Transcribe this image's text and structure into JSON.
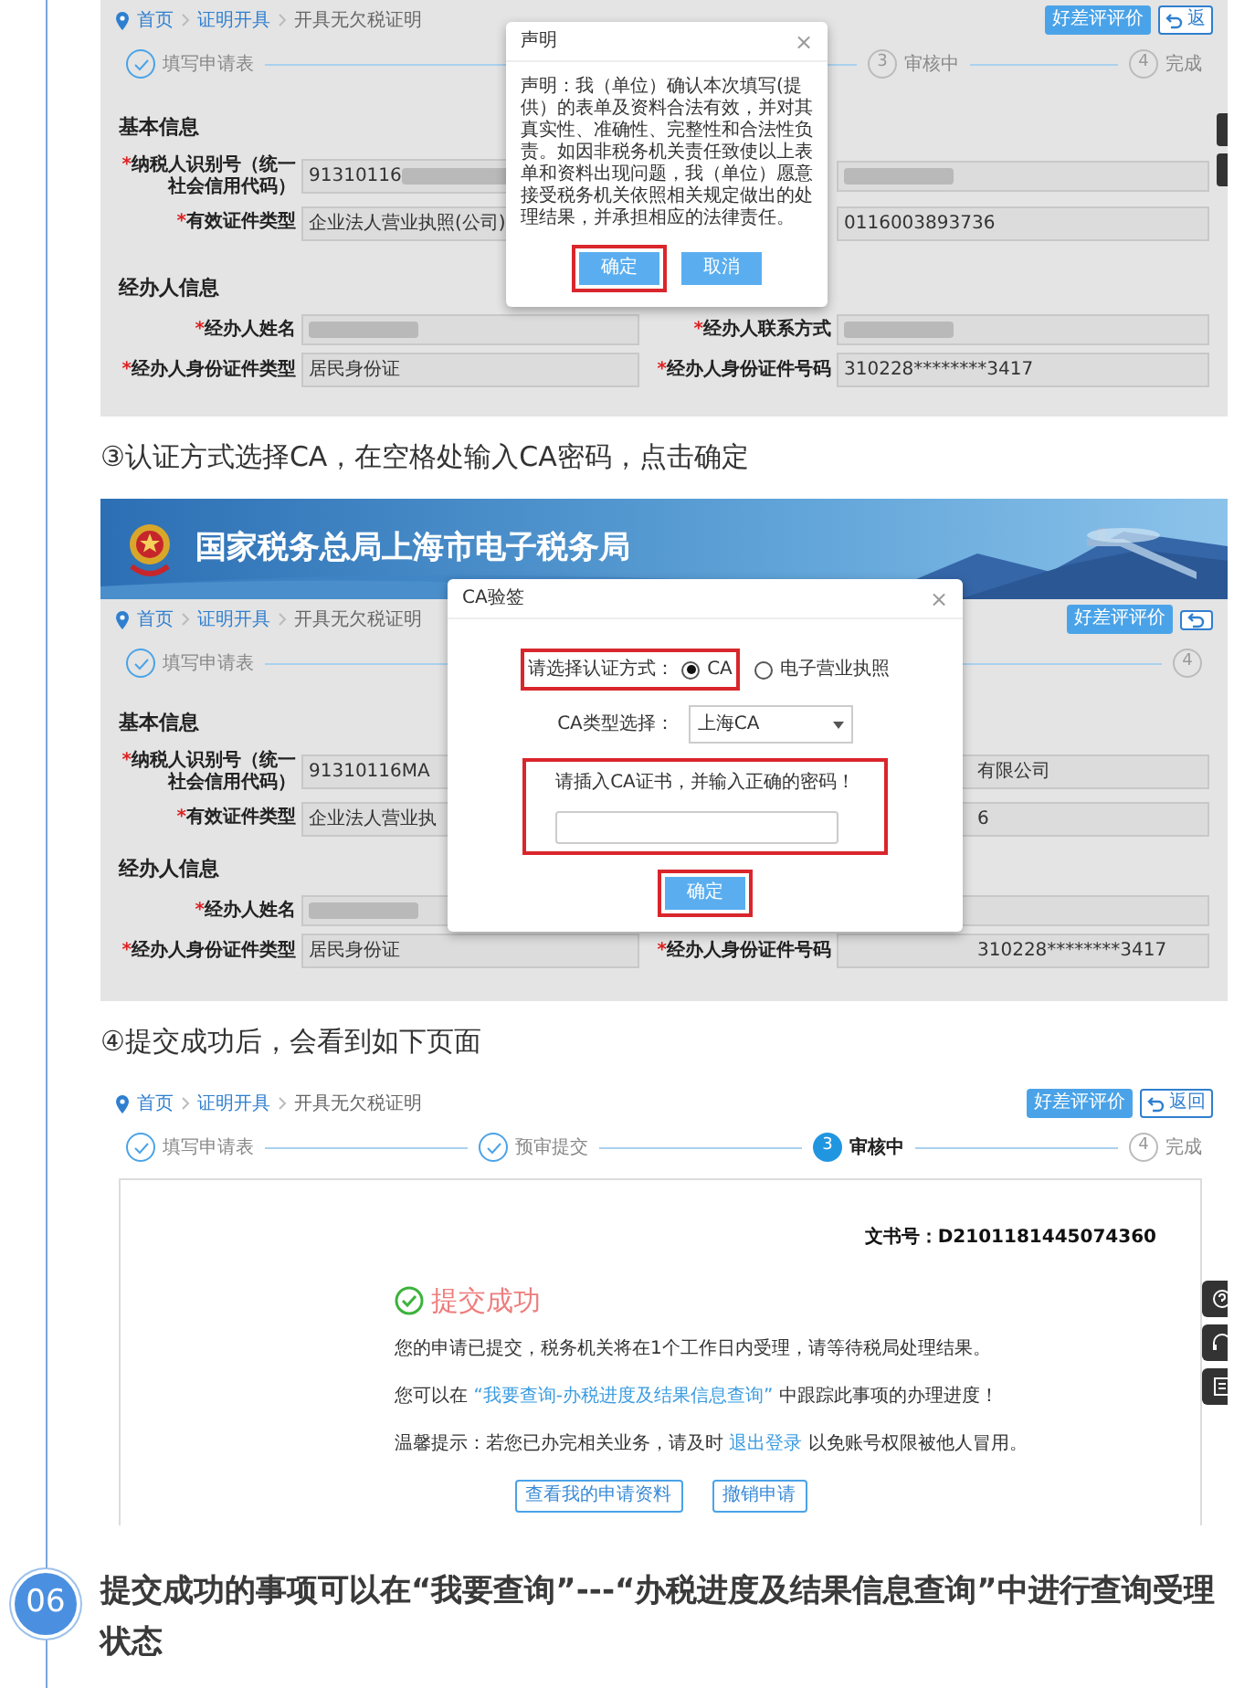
{
  "panels": [
    {
      "kind": "declaration",
      "breadcrumb": [
        "首页",
        "证明开具",
        "开具无欠税证明"
      ],
      "actions": [
        {
          "kind": "rate",
          "label": "好差评评价"
        },
        {
          "kind": "back",
          "label": "返"
        }
      ],
      "steps": [
        {
          "done": true,
          "active": false,
          "label": "填写申请表"
        },
        {
          "done": false,
          "active": false,
          "number": "3",
          "label": "审核中"
        },
        {
          "done": false,
          "active": false,
          "number": "4",
          "label": "完成"
        }
      ],
      "sections": [
        {
          "title": "基本信息",
          "rows": [
            [
              {
                "asterisk": "*",
                "label": "纳税人识别号（统一社会信用代码）",
                "value": "91310116",
                "redacted": true
              },
              {
                "redacted": true
              }
            ],
            [
              {
                "asterisk": "*",
                "label": "有效证件类型",
                "value": "企业法人营业执照(公司)"
              },
              {
                "value": "0116003893736"
              }
            ]
          ]
        },
        {
          "title": "经办人信息",
          "rows": [
            [
              {
                "asterisk": "*",
                "label": "经办人姓名",
                "redacted": true
              },
              {
                "asterisk": "*",
                "label": "经办人联系方式",
                "redacted": true
              }
            ],
            [
              {
                "asterisk": "*",
                "label": "经办人身份证件类型",
                "value": "居民身份证"
              },
              {
                "asterisk": "*",
                "label": "经办人身份证件号码",
                "value": "310228********3417"
              }
            ]
          ]
        }
      ],
      "dialog": {
        "title": "声明",
        "close": "×",
        "body": "声明：我（单位）确认本次填写(提供）的表单及资料合法有效，并对其真实性、准确性、完整性和合法性负责。如因非税务机关责任致使以上表单和资料出现问题，我（单位）愿意接受税务机关依照相关规定做出的处理结果，并承担相应的法律责任。",
        "buttons": [
          {
            "label": "确定",
            "highlighted": true
          },
          {
            "label": "取消",
            "highlighted": false
          }
        ]
      },
      "side_widgets": [
        {
          "kind": "tab"
        },
        {
          "kind": "tab"
        }
      ]
    },
    {
      "kind": "caption",
      "text": "③认证方式选择CA，在空格处输入CA密码，点击确定"
    },
    {
      "kind": "ca-sign",
      "banner": {
        "title": "国家税务总局上海市电子税务局"
      },
      "breadcrumb": [
        "首页",
        "证明开具",
        "开具无欠税证明"
      ],
      "actions": [
        {
          "kind": "rate",
          "label": "好差评评价"
        },
        {
          "kind": "back"
        }
      ],
      "steps": [
        {
          "done": true,
          "active": false,
          "label": "填写申请表"
        },
        {
          "done": false,
          "active": false,
          "number": "4"
        }
      ],
      "sections": [
        {
          "title": "基本信息",
          "rows": [
            [
              {
                "asterisk": "*",
                "label": "纳税人识别号（统一社会信用代码）",
                "value": "91310116MA"
              },
              {
                "value": "有限公司"
              }
            ],
            [
              {
                "asterisk": "*",
                "label": "有效证件类型",
                "value": "企业法人营业执"
              },
              {
                "value": "6"
              }
            ]
          ]
        },
        {
          "title": "经办人信息",
          "rows": [
            [
              {
                "asterisk": "*",
                "label": "经办人姓名",
                "redacted": true
              },
              {}
            ],
            [
              {
                "asterisk": "*",
                "label": "经办人身份证件类型",
                "value": "居民身份证"
              },
              {
                "asterisk": "*",
                "label": "经办人身份证件号码",
                "value": "310228********3417"
              }
            ]
          ]
        }
      ],
      "dialog": {
        "title": "CA验签",
        "close": "×",
        "method_label": "请选择认证方式：",
        "method_highlighted": true,
        "methods": [
          {
            "label": "CA",
            "selected": true
          },
          {
            "label": "电子营业执照",
            "selected": false
          }
        ],
        "type_label": "CA类型选择：",
        "type_value": "上海CA",
        "prompt": "请插入CA证书，并输入正确的密码！",
        "prompt_highlighted": true,
        "buttons": [
          {
            "label": "确定",
            "highlighted": true
          }
        ]
      }
    },
    {
      "kind": "caption",
      "text": "④提交成功后，会看到如下页面"
    },
    {
      "kind": "result",
      "breadcrumb": [
        "首页",
        "证明开具",
        "开具无欠税证明"
      ],
      "actions": [
        {
          "kind": "rate",
          "label": "好差评评价"
        },
        {
          "kind": "back",
          "label": "返回"
        }
      ],
      "steps": [
        {
          "done": true,
          "active": false,
          "label": "填写申请表"
        },
        {
          "done": true,
          "active": false,
          "label": "预审提交"
        },
        {
          "done": false,
          "active": true,
          "number": "3",
          "label": "审核中"
        },
        {
          "done": false,
          "active": false,
          "number": "4",
          "label": "完成"
        }
      ],
      "doc_number": "文书号：D2101181445074360",
      "result_title": "提交成功",
      "messages": [
        [
          {
            "text": "您的申请已提交，税务机关将在1个工作日内受理，请等待税局处理结果。"
          }
        ],
        [
          {
            "text": "您可以在 "
          },
          {
            "text": "“我要查询-办税进度及结果信息查询”",
            "link": true
          },
          {
            "text": " 中跟踪此事项的办理进度！"
          }
        ],
        [
          {
            "text": "温馨提示：若您已办完相关业务，请及时 "
          },
          {
            "text": "退出登录",
            "link": true
          },
          {
            "text": " 以免账号权限被他人冒用。"
          }
        ]
      ],
      "buttons": [
        "查看我的申请资料",
        "撤销申请"
      ],
      "side_widgets": [
        {
          "kind": "help"
        },
        {
          "kind": "headset"
        },
        {
          "kind": "document"
        }
      ]
    }
  ],
  "step_heading": {
    "number": "06",
    "text": "提交成功的事项可以在“我要查询”---“办税进度及结果信息查询”中进行查询受理状态"
  }
}
